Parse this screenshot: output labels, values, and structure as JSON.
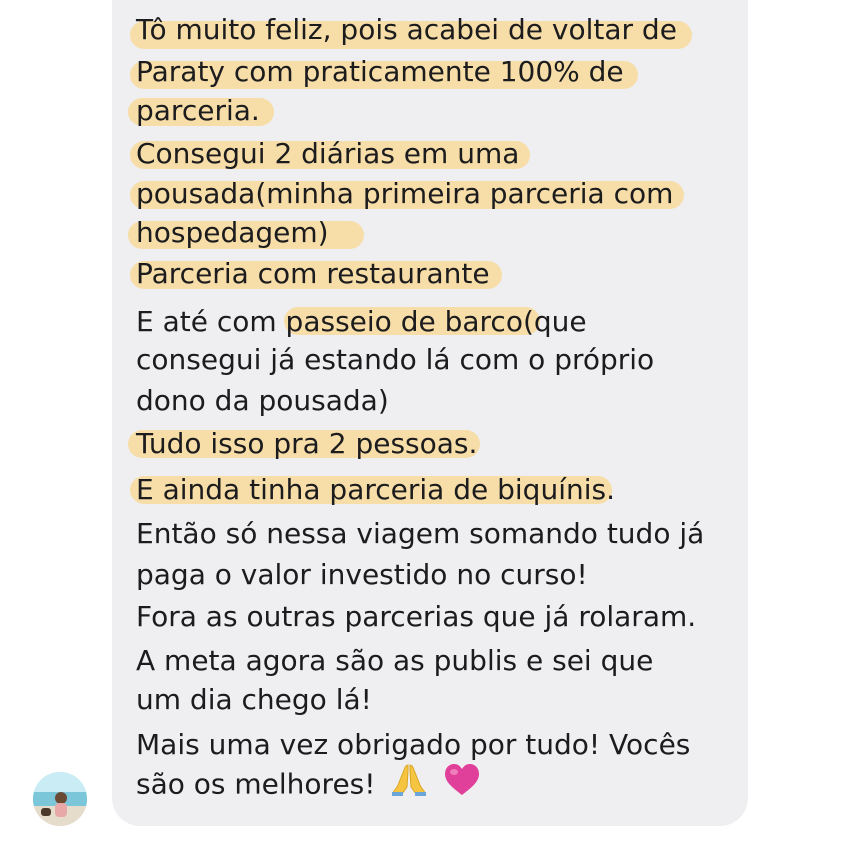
{
  "message": {
    "lines": [
      "Tô muito feliz, pois acabei de voltar de",
      "Paraty com praticamente 100% de",
      "parceria.",
      "Consegui 2 diárias em uma",
      "pousada(minha primeira parceria com",
      "hospedagem)",
      "Parceria com restaurante",
      "E até com passeio de barco(que",
      "consegui já estando lá com o próprio",
      "dono da pousada)",
      "Tudo isso pra 2 pessoas.",
      "E ainda tinha parceria de biquínis.",
      "Então só nessa viagem somando tudo já",
      "paga o valor investido no curso!",
      "Fora as outras parcerias que já rolaram.",
      "A meta agora são as publis e sei que",
      "um dia chego lá!",
      "Mais uma vez obrigado por tudo! Vocês",
      "são os melhores!"
    ],
    "emojis": [
      "folded-hands",
      "pink-heart"
    ]
  },
  "colors": {
    "bubble": "#efeff1",
    "text": "#1c1c1e",
    "highlight": "#f7dca3",
    "heart": "#e0409a",
    "hands": "#f5c542"
  },
  "avatar": {
    "icon": "user-avatar-photo"
  }
}
